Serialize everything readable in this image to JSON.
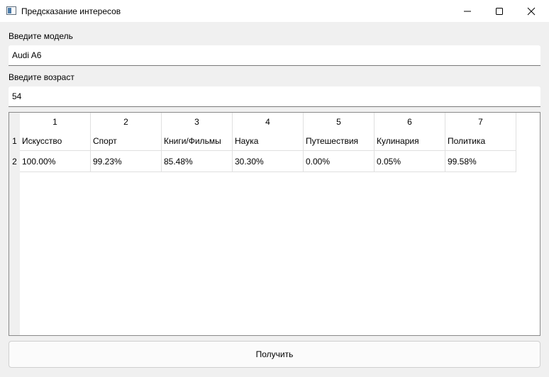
{
  "window": {
    "title": "Предсказание интересов",
    "icon": "app-window-icon",
    "controls": [
      "minimize-icon",
      "maximize-icon",
      "close-icon"
    ]
  },
  "form": {
    "model_label": "Введите модель",
    "model_value": "Audi A6",
    "age_label": "Введите возраст",
    "age_value": "54"
  },
  "table": {
    "column_headers": [
      "1",
      "2",
      "3",
      "4",
      "5",
      "6",
      "7"
    ],
    "row_headers": [
      "1",
      "2"
    ],
    "rows": [
      [
        "Искусство",
        "Спорт",
        "Книги/Фильмы",
        "Наука",
        "Путешествия",
        "Кулинария",
        "Политика"
      ],
      [
        "100.00%",
        "99.23%",
        "85.48%",
        "30.30%",
        "0.00%",
        "0.05%",
        "99.58%"
      ]
    ]
  },
  "actions": {
    "submit_label": "Получить"
  }
}
